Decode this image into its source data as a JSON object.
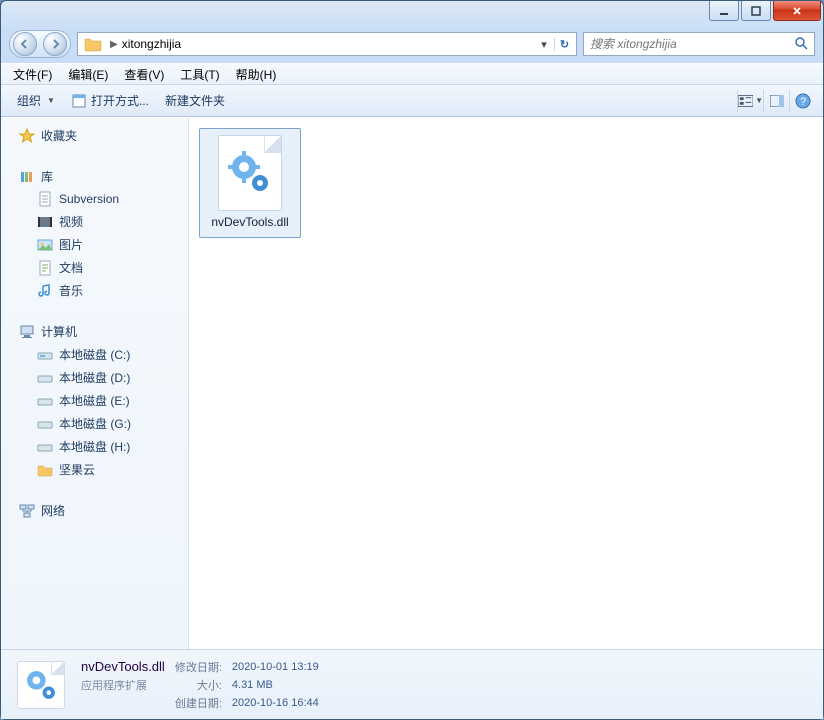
{
  "titlebar": {
    "min_tip": "Minimize",
    "max_tip": "Maximize",
    "close_tip": "Close"
  },
  "nav": {
    "path": "xitongzhijia",
    "search_placeholder": "搜索 xitongzhijia"
  },
  "menu": {
    "file": "文件(F)",
    "edit": "编辑(E)",
    "view": "查看(V)",
    "tools": "工具(T)",
    "help": "帮助(H)"
  },
  "toolbar": {
    "organize": "组织",
    "open_with": "打开方式...",
    "new_folder": "新建文件夹"
  },
  "sidebar": {
    "favorites": "收藏夹",
    "libraries": "库",
    "lib_items": [
      "Subversion",
      "视频",
      "图片",
      "文档",
      "音乐"
    ],
    "computer": "计算机",
    "drives": [
      "本地磁盘 (C:)",
      "本地磁盘 (D:)",
      "本地磁盘 (E:)",
      "本地磁盘 (G:)",
      "本地磁盘 (H:)",
      "坚果云"
    ],
    "network": "网络"
  },
  "content": {
    "files": [
      {
        "name": "nvDevTools.dll"
      }
    ]
  },
  "details": {
    "name": "nvDevTools.dll",
    "type": "应用程序扩展",
    "mod_label": "修改日期:",
    "mod_value": "2020-10-01 13:19",
    "size_label": "大小:",
    "size_value": "4.31 MB",
    "create_label": "创建日期:",
    "create_value": "2020-10-16 16:44"
  }
}
